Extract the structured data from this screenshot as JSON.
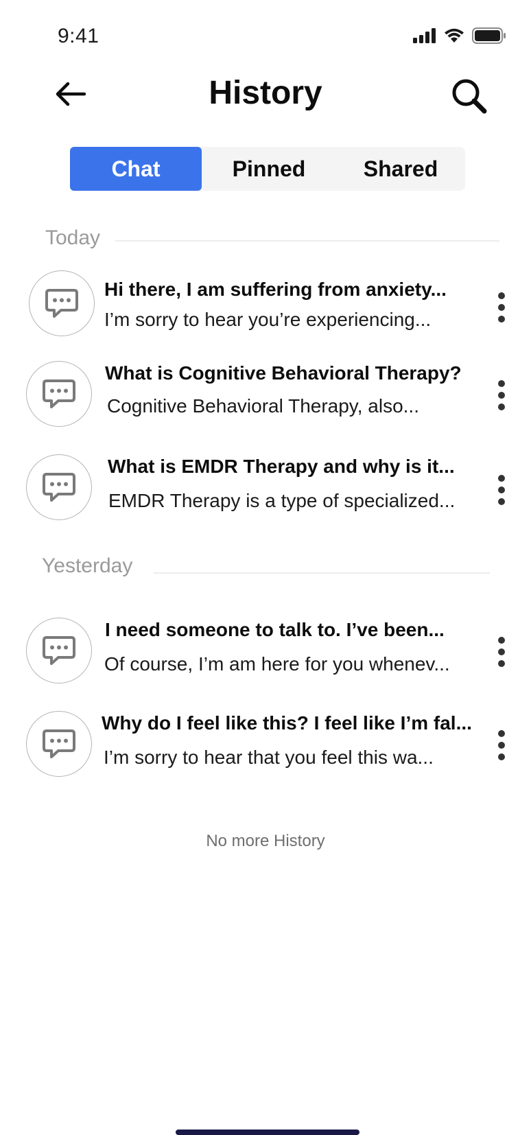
{
  "status_bar": {
    "time": "9:41"
  },
  "header": {
    "title": "History"
  },
  "tabs": [
    {
      "label": "Chat",
      "active": true
    },
    {
      "label": "Pinned",
      "active": false
    },
    {
      "label": "Shared",
      "active": false
    }
  ],
  "sections": [
    {
      "label": "Today",
      "items": [
        {
          "title": "Hi there, I am suffering from anxiety...",
          "preview": "I’m sorry to hear you’re experiencing..."
        },
        {
          "title": "What is Cognitive Behavioral Therapy?",
          "preview": "Cognitive Behavioral Therapy, also..."
        },
        {
          "title": "What is EMDR Therapy and why is it...",
          "preview": "EMDR Therapy is a type of specialized..."
        }
      ]
    },
    {
      "label": "Yesterday",
      "items": [
        {
          "title": "I need someone to talk to. I’ve been...",
          "preview": "Of course, I’m am here for you whenev..."
        },
        {
          "title": "Why do I feel like this? I feel like I’m fal...",
          "preview": "I’m sorry to hear that you feel this wa..."
        }
      ]
    }
  ],
  "footer": {
    "note": "No more History"
  },
  "colors": {
    "accent": "#3b73ea",
    "tab_bg": "#f4f4f4",
    "muted_text": "#9a9a9a",
    "home_indicator": "#1a1846"
  },
  "icons": [
    "signal-icon",
    "wifi-icon",
    "battery-icon",
    "back-arrow-icon",
    "search-icon",
    "chat-bubble-icon",
    "more-vertical-icon"
  ]
}
